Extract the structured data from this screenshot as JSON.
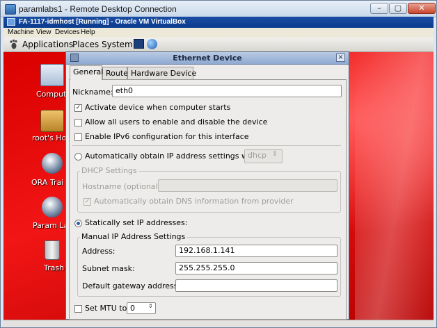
{
  "rdp": {
    "title": "paramlabs1 - Remote Desktop Connection",
    "min": "–",
    "max": "▢",
    "close": "✕"
  },
  "vbox": {
    "title": "FA-1117-idmhost [Running] - Oracle VM VirtualBox",
    "menu": [
      "Machine",
      "View",
      "Devices",
      "Help"
    ]
  },
  "guest_panel": {
    "menu": [
      "Applications",
      "Places",
      "System"
    ]
  },
  "desktop": {
    "icons": [
      "Comput",
      "root's Ho",
      "ORA Trai",
      "Param La",
      "Trash"
    ]
  },
  "dialog": {
    "title": "Ethernet Device",
    "close": "×",
    "tabs": [
      "General",
      "Route",
      "Hardware Device"
    ],
    "nickname_label": "Nickname:",
    "nickname_value": "eth0",
    "activate_label": "Activate device when computer starts",
    "allow_users_label": "Allow all users to enable and disable the device",
    "ipv6_label": "Enable IPv6 configuration for this interface",
    "auto_ip_label": "Automatically obtain IP address settings with:",
    "auto_ip_select": "dhcp",
    "dhcp_frame": "DHCP Settings",
    "hostname_label": "Hostname (optional):",
    "auto_dns_label": "Automatically obtain DNS information from provider",
    "static_label": "Statically set IP addresses:",
    "manual_frame": "Manual IP Address Settings",
    "address_label": "Address:",
    "address_value": "192.168.1.141",
    "subnet_label": "Subnet mask:",
    "subnet_value": "255.255.255.0",
    "gateway_label": "Default gateway address:",
    "gateway_value": "",
    "mtu_label": "Set MTU to:",
    "mtu_value": "0"
  },
  "colors": {
    "desktop_red": "#d90000",
    "vbox_blue": "#0c3b8e",
    "radio_dot": "#2f5fa8"
  }
}
